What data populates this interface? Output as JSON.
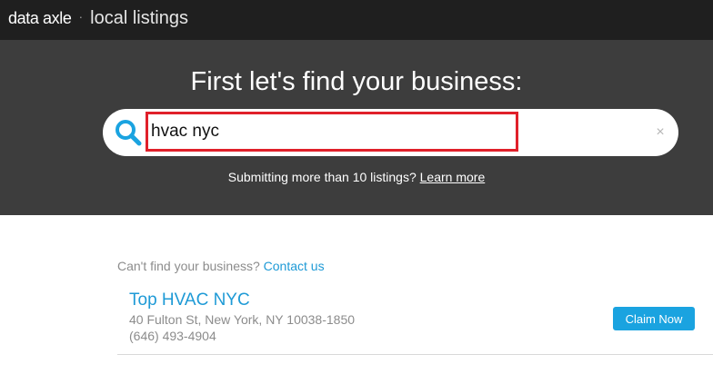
{
  "header": {
    "brand_name": "data axle",
    "separator": "·",
    "product": "local listings"
  },
  "hero": {
    "title": "First let's find your business:",
    "search": {
      "value": "hvac nyc",
      "icon": "search-icon",
      "clear_glyph": "×"
    },
    "note_text": "Submitting more than 10 listings?",
    "note_link": "Learn more"
  },
  "results": {
    "cant_find_text": "Can't find your business?",
    "contact_link": "Contact us",
    "items": [
      {
        "name": "Top HVAC NYC",
        "address": "40 Fulton St, New York, NY 10038-1850",
        "phone": "(646) 493-4904",
        "action": "Claim Now"
      }
    ]
  },
  "colors": {
    "topbar": "#1f1f1f",
    "hero": "#3d3d3d",
    "accent": "#1e9ad6",
    "highlight": "#e0202a"
  }
}
